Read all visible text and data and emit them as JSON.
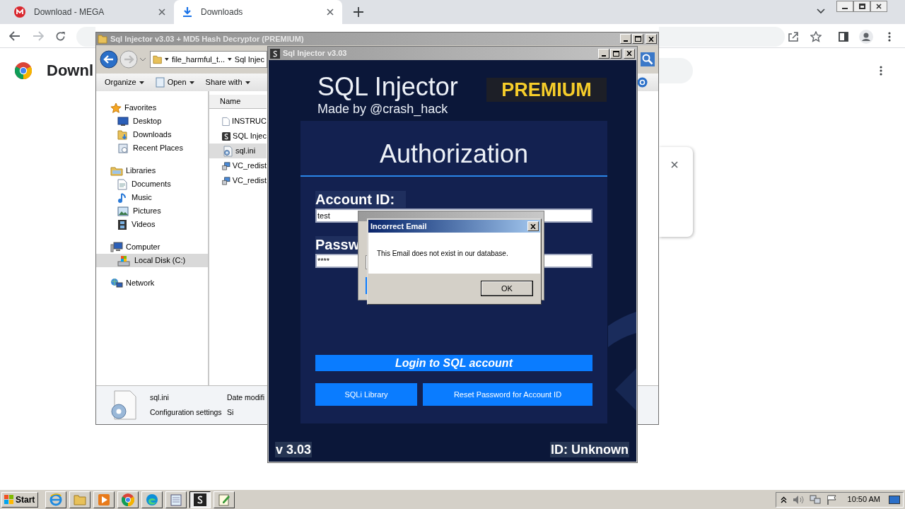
{
  "browser": {
    "tabs": [
      {
        "title": "Download - MEGA",
        "selected": false,
        "kind": "mega"
      },
      {
        "title": "Downloads",
        "selected": true,
        "kind": "download"
      }
    ],
    "page_title": "Downl"
  },
  "explorer": {
    "title": "Sql Injector v3.03 + MD5 Hash Decryptor (PREMIUM)",
    "breadcrumb": [
      "file_harmful_t...",
      "Sql Injec"
    ],
    "toolbar": [
      "Organize",
      "Open",
      "Share with"
    ],
    "nav": [
      {
        "label": "Favorites",
        "selected": false,
        "children": [
          {
            "label": "Desktop",
            "selected": false
          },
          {
            "label": "Downloads",
            "selected": false
          },
          {
            "label": "Recent Places",
            "selected": false
          }
        ]
      },
      {
        "label": "Libraries",
        "selected": false,
        "children": [
          {
            "label": "Documents",
            "selected": false
          },
          {
            "label": "Music",
            "selected": false
          },
          {
            "label": "Pictures",
            "selected": false
          },
          {
            "label": "Videos",
            "selected": false
          }
        ]
      },
      {
        "label": "Computer",
        "selected": false,
        "children": [
          {
            "label": "Local Disk (C:)",
            "selected": true
          }
        ]
      },
      {
        "label": "Network",
        "selected": false
      }
    ],
    "column": "Name",
    "files": [
      {
        "name": "INSTRUC",
        "kind": "text",
        "selected": false
      },
      {
        "name": "SQL Injec",
        "kind": "app",
        "selected": false
      },
      {
        "name": "sql.ini",
        "kind": "settings",
        "selected": true
      },
      {
        "name": "VC_redist",
        "kind": "installer",
        "selected": false
      },
      {
        "name": "VC_redist",
        "kind": "installer",
        "selected": false
      }
    ],
    "details": {
      "name": "sql.ini",
      "type": "Configuration settings",
      "date_label": "Date modifi",
      "size_label": "Si"
    }
  },
  "injector": {
    "title": "Sql Injector v3.03",
    "app_name": "SQL Injector",
    "author": "Made by @crash_hack",
    "badge": "PREMIUM",
    "heading": "Authorization",
    "fields": [
      {
        "label": "Account ID:",
        "value": "test"
      },
      {
        "label": "Passw",
        "value": "****"
      }
    ],
    "login_button": "Login to SQL account",
    "buttons": [
      "SQLi Library",
      "Reset Password for Account ID"
    ],
    "version": "v 3.03",
    "id_text": "ID: Unknown"
  },
  "dialog": {
    "title": "Incorrect Email",
    "message": "This Email does not exist in our database.",
    "button": "OK"
  },
  "taskbar": {
    "start": "Start",
    "apps": [
      {
        "kind": "ie",
        "selected": false
      },
      {
        "kind": "folder",
        "selected": false
      },
      {
        "kind": "media",
        "selected": false
      },
      {
        "kind": "chrome",
        "selected": false
      },
      {
        "kind": "edge",
        "selected": false
      },
      {
        "kind": "notepad",
        "selected": false
      },
      {
        "kind": "injector",
        "selected": true
      },
      {
        "kind": "editor",
        "selected": false
      }
    ],
    "clock": "10:50 AM"
  }
}
